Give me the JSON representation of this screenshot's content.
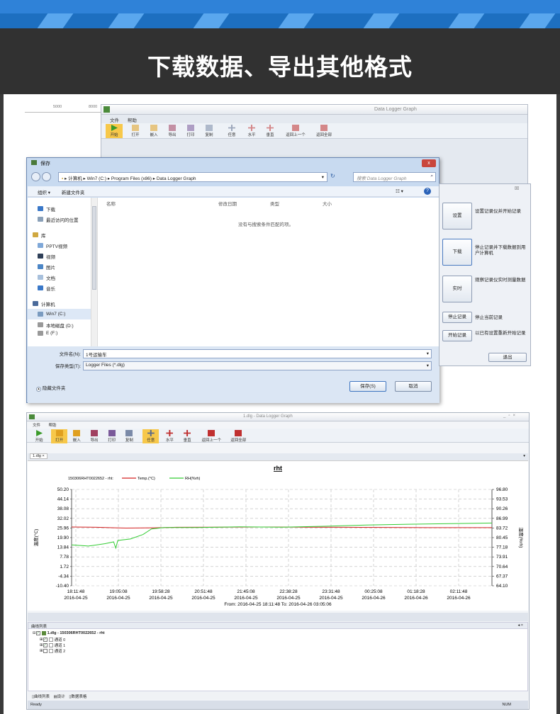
{
  "banner": {
    "title": "下载数据、导出其他格式"
  },
  "app1": {
    "title": "Data Logger Graph",
    "menu": [
      "文件",
      "帮助"
    ],
    "toolbar": [
      "开始",
      "打开",
      "嵌入",
      "导出",
      "打印",
      "复制",
      "任意",
      "水平",
      "垂直",
      "返回上一个",
      "返回全部"
    ],
    "ruler": [
      "5000",
      "8000"
    ]
  },
  "dialog": {
    "title": "保存",
    "close": "x",
    "path": [
      "计算机",
      "Win7 (C:)",
      "Program Files (x86)",
      "Data Logger Graph"
    ],
    "search_placeholder": "搜索 Data Logger Graph",
    "organize": "组织 ▾",
    "new_folder": "新建文件夹",
    "nav": [
      "下载",
      "最近访问的位置",
      "库",
      "PPTV视频",
      "视频",
      "图片",
      "文档",
      "音乐",
      "计算机",
      "Win7 (C:)",
      "本地磁盘 (D:)",
      "E (F:)"
    ],
    "columns": [
      "名称",
      "修改日期",
      "类型",
      "大小"
    ],
    "empty": "没有与搜索条件匹配的项。",
    "filename_label": "文件名(N):",
    "filename_value": "1号运输车",
    "filetype_label": "保存类型(T):",
    "filetype_value": "Logger Files (*.dlg)",
    "hide_folders": "隐藏文件夹",
    "save": "保存(S)",
    "cancel": "取消"
  },
  "panel": {
    "close": "☒",
    "buttons": [
      {
        "label": "设置",
        "desc": "设置记录仪并开始记录"
      },
      {
        "label": "下载",
        "desc": "停止记录并下载数据到用户计算机"
      },
      {
        "label": "实时",
        "desc": "观察记录仪实时测量数据"
      },
      {
        "label": "停止记录",
        "desc": "停止当前记录"
      },
      {
        "label": "开始记录",
        "desc": "以已有设置重新开始记录"
      }
    ],
    "exit": "退出"
  },
  "app2": {
    "title": "1.dlg - Data Logger Graph",
    "menu": [
      "文件",
      "帮助"
    ],
    "toolbar": [
      "开始",
      "打开",
      "嵌入",
      "导出",
      "打印",
      "复制",
      "任意",
      "水平",
      "垂直",
      "返回上一个",
      "返回全部"
    ],
    "tab": "1.dlg",
    "chart_title": "rht",
    "legend_prefix": "150306RHT0022652 - rht:",
    "range": "From: 2016-04-25 18:11:48  To: 2016-04-26 03:05:06",
    "list_title": "曲线列表",
    "tree": [
      "1.dlg - 150306RHT0022652 - rht",
      "通道 0",
      "通道 1",
      "通道 2"
    ],
    "bottom_tabs": [
      "曲线列表",
      "设计",
      "数据表格"
    ],
    "status": "Ready",
    "status_right": "NUM"
  },
  "chart_data": {
    "type": "line",
    "title": "rht",
    "ylabel": "温度(°C)",
    "y2label": "湿度(%rh)",
    "yticks": [
      "50.20",
      "44.14",
      "38.08",
      "32.02",
      "25.96",
      "19.90",
      "13.84",
      "7.78",
      "1.72",
      "-4.34",
      "-10.40"
    ],
    "y2ticks": [
      "96.80",
      "93.53",
      "90.26",
      "86.99",
      "83.72",
      "80.45",
      "77.18",
      "73.91",
      "70.64",
      "67.37",
      "64.10"
    ],
    "xticks": [
      [
        "18:11:48",
        "2016-04-25"
      ],
      [
        "19:05:08",
        "2016-04-25"
      ],
      [
        "19:58:28",
        "2016-04-25"
      ],
      [
        "20:51:48",
        "2016-04-25"
      ],
      [
        "21:45:08",
        "2016-04-25"
      ],
      [
        "22:38:28",
        "2016-04-25"
      ],
      [
        "23:31:48",
        "2016-04-25"
      ],
      [
        "00:25:08",
        "2016-04-26"
      ],
      [
        "01:18:28",
        "2016-04-26"
      ],
      [
        "02:11:48",
        "2016-04-26"
      ]
    ],
    "ylim": [
      -10.4,
      50.2
    ],
    "y2lim": [
      64.1,
      96.8
    ],
    "series": [
      {
        "name": "Temp.(°C)",
        "color": "#d42020",
        "axis": "left",
        "points": [
          [
            0,
            26.6
          ],
          [
            0.06,
            26.4
          ],
          [
            0.11,
            26.0
          ],
          [
            0.13,
            25.9
          ],
          [
            0.2,
            26.1
          ],
          [
            0.25,
            26.4
          ],
          [
            0.35,
            26.5
          ],
          [
            0.45,
            26.6
          ],
          [
            0.55,
            26.5
          ],
          [
            0.65,
            26.4
          ],
          [
            0.75,
            26.3
          ],
          [
            0.85,
            26.2
          ],
          [
            0.95,
            26.2
          ],
          [
            1,
            26.2
          ]
        ]
      },
      {
        "name": "RH(%rh)",
        "color": "#33cc33",
        "axis": "right",
        "points": [
          [
            0,
            78.0
          ],
          [
            0.04,
            77.6
          ],
          [
            0.08,
            78.4
          ],
          [
            0.1,
            79.0
          ],
          [
            0.105,
            76.9
          ],
          [
            0.11,
            79.5
          ],
          [
            0.14,
            80.0
          ],
          [
            0.17,
            81.5
          ],
          [
            0.19,
            83.4
          ],
          [
            0.22,
            83.9
          ],
          [
            0.3,
            83.9
          ],
          [
            0.4,
            84.1
          ],
          [
            0.5,
            84.0
          ],
          [
            0.6,
            84.3
          ],
          [
            0.7,
            84.7
          ],
          [
            0.8,
            85.0
          ],
          [
            0.9,
            85.2
          ],
          [
            1,
            85.4
          ]
        ]
      }
    ]
  }
}
